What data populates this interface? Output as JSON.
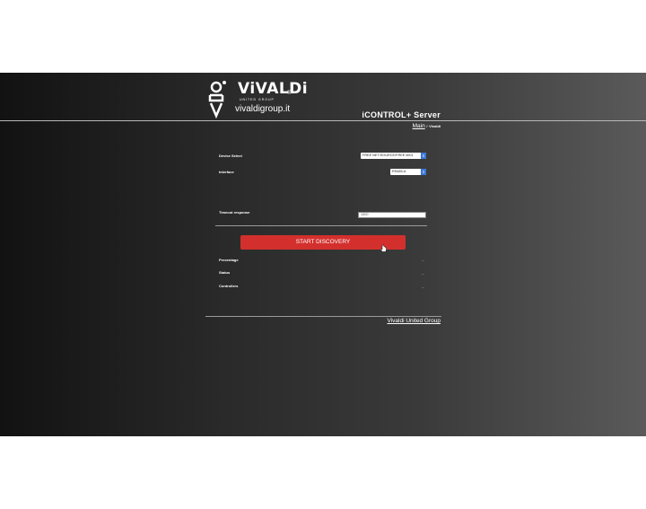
{
  "header": {
    "brand_name": "ViVALDi",
    "brand_tagline": "UNITED GROUP",
    "brand_mark": "®",
    "brand_site": "vivaldigroup.it",
    "server_title": "iCONTROL+ Server",
    "logo_icon": "vivaldi-logo-icon"
  },
  "breadcrumb": {
    "link": "Main",
    "separator": "/",
    "current": "Vivaldi"
  },
  "form": {
    "device_select_label": "Device Select",
    "device_select_value": "FREE NET/SOURCE/FREE MK3",
    "interface_label": "Interface",
    "interface_value": "RS485-A",
    "timeout_label": "Timeout response",
    "timeout_value": "1500",
    "start_button": "START DISCOVERY"
  },
  "status": {
    "percentage_label": "Precentage",
    "percentage_value": "...",
    "status_label": "Status",
    "status_value": "...",
    "controllers_label": "Controllers",
    "controllers_value": "..."
  },
  "footer": {
    "link": "Vivaldi United Group"
  },
  "colors": {
    "accent_button": "#d3302d",
    "select_arrow": "#3a78d8"
  }
}
